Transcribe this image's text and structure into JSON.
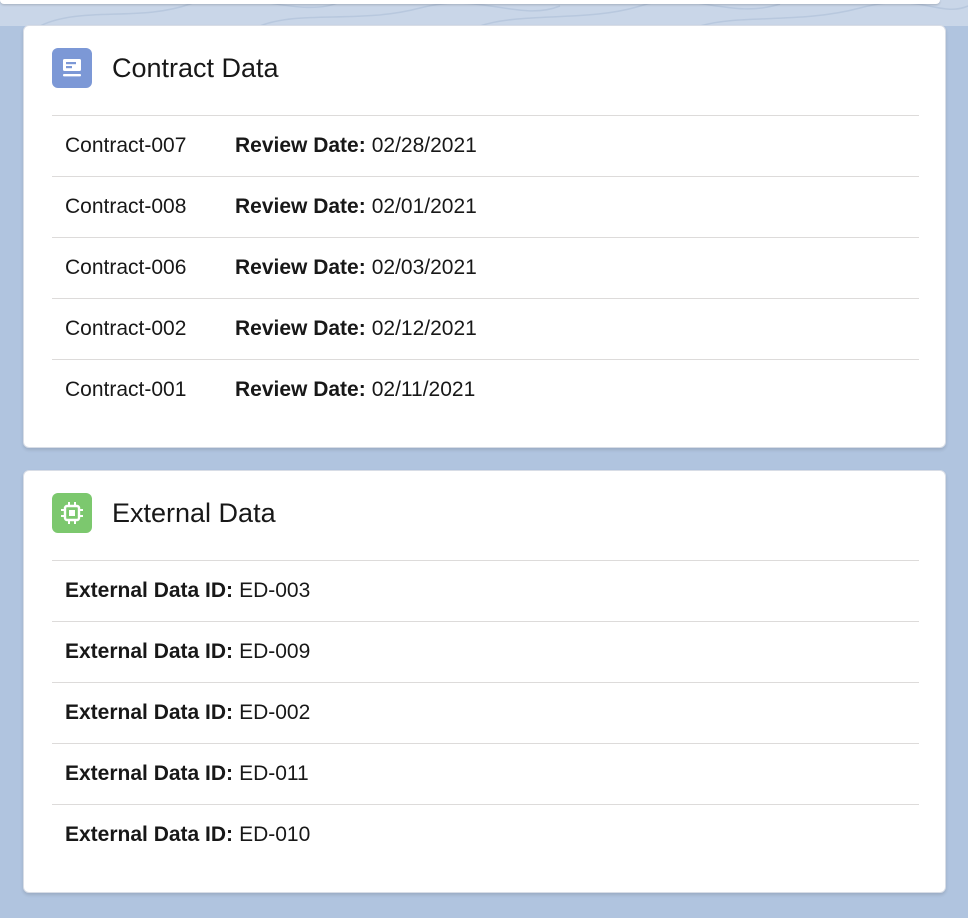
{
  "colors": {
    "page_background": "#b0c4df",
    "contract_icon_bg": "#7c98d6",
    "external_icon_bg": "#7cc86e"
  },
  "contract_card": {
    "title": "Contract Data",
    "icon": "contract-icon",
    "review_label": "Review Date:",
    "rows": [
      {
        "name": "Contract-007",
        "review_date": "02/28/2021"
      },
      {
        "name": "Contract-008",
        "review_date": "02/01/2021"
      },
      {
        "name": "Contract-006",
        "review_date": "02/03/2021"
      },
      {
        "name": "Contract-002",
        "review_date": "02/12/2021"
      },
      {
        "name": "Contract-001",
        "review_date": "02/11/2021"
      }
    ]
  },
  "external_card": {
    "title": "External Data",
    "icon": "chip-icon",
    "id_label": "External Data ID:",
    "rows": [
      {
        "external_id": "ED-003"
      },
      {
        "external_id": "ED-009"
      },
      {
        "external_id": "ED-002"
      },
      {
        "external_id": "ED-011"
      },
      {
        "external_id": "ED-010"
      }
    ]
  }
}
